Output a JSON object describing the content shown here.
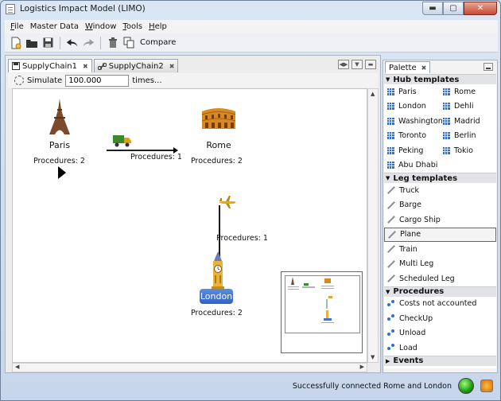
{
  "window": {
    "title": "Logistics Impact Model (LIMO)",
    "min": "▬",
    "max": "▢",
    "close": "✕"
  },
  "menubar": [
    {
      "key": "F",
      "rest": "ile"
    },
    {
      "key": "",
      "rest": "Master Data"
    },
    {
      "key": "W",
      "rest": "indow"
    },
    {
      "key": "T",
      "rest": "ools"
    },
    {
      "key": "H",
      "rest": "elp"
    }
  ],
  "toolbar": {
    "compare_label": "Compare"
  },
  "editor": {
    "tabs": [
      {
        "label": "SupplyChain1",
        "active": true
      },
      {
        "label": "SupplyChain2",
        "active": false
      }
    ],
    "simulate_label": "Simulate",
    "times_value": "100.000",
    "times_label": "times..."
  },
  "diagram": {
    "nodes": [
      {
        "name": "Paris",
        "procedures": "Procedures: 2"
      },
      {
        "name": "Rome",
        "procedures": "Procedures: 2"
      },
      {
        "name": "London",
        "procedures": "Procedures: 2"
      }
    ],
    "legs": [
      {
        "procedures": "Procedures: 1"
      },
      {
        "procedures": "Procedures: 1"
      }
    ]
  },
  "palette": {
    "title": "Palette",
    "hub_header": "Hub templates",
    "hubs": [
      "Paris",
      "Rome",
      "London",
      "Dehli",
      "Washington",
      "Madrid",
      "Toronto",
      "Berlin",
      "Peking",
      "Tokio",
      "Abu Dhabi"
    ],
    "leg_header": "Leg templates",
    "legs": [
      "Truck",
      "Barge",
      "Cargo Ship",
      "Plane",
      "Train",
      "Multi Leg",
      "Scheduled Leg"
    ],
    "selected_leg": "Plane",
    "proc_header": "Procedures",
    "procedures": [
      "Costs not accounted",
      "CheckUp",
      "Unload",
      "Load"
    ],
    "events_header": "Events"
  },
  "status": {
    "message": "Successfully connected Rome and London"
  }
}
